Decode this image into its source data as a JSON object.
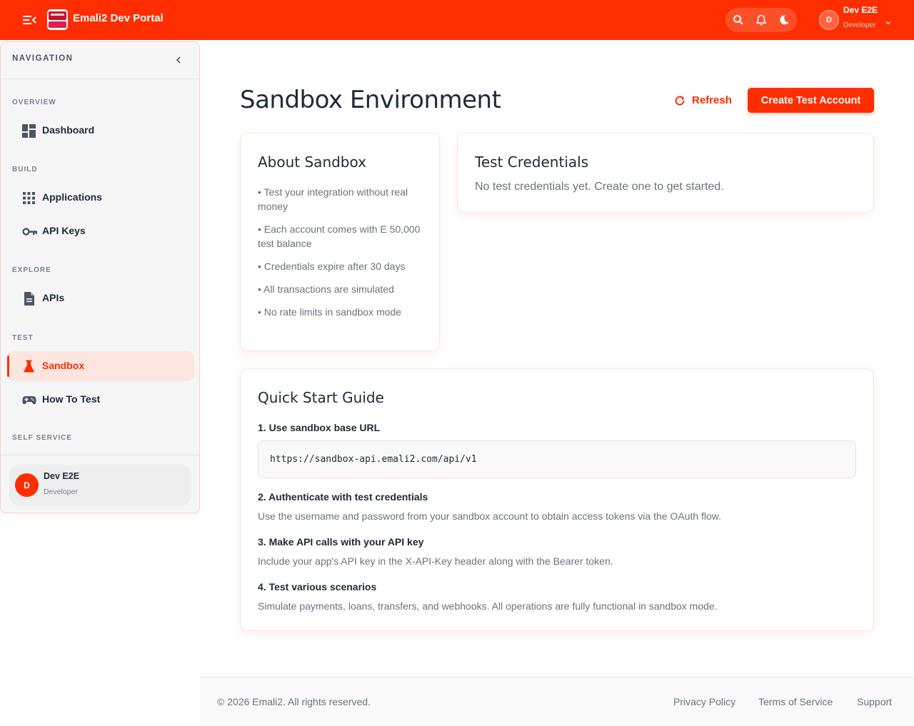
{
  "app": {
    "title": "Emali2 Dev Portal",
    "brand_color": "#ff2e00"
  },
  "header": {
    "icons": [
      "menu-icon",
      "search-icon",
      "bell-icon",
      "moon-icon",
      "chevron-down-icon"
    ],
    "user": {
      "initial": "D",
      "name": "Dev E2E",
      "role": "Developer"
    }
  },
  "sidebar": {
    "title": "NAVIGATION",
    "sections": {
      "overview": "OVERVIEW",
      "build": "BUILD",
      "explore": "EXPLORE",
      "test": "TEST",
      "self_service": "SELF SERVICE"
    },
    "items": {
      "dashboard": "Dashboard",
      "applications": "Applications",
      "api_keys": "API Keys",
      "apis": "APIs",
      "sandbox": "Sandbox",
      "how_to_test": "How To Test"
    },
    "active_item": "Sandbox",
    "user": {
      "initial": "D",
      "name": "Dev E2E",
      "role": "Developer"
    }
  },
  "main": {
    "title": "Sandbox Environment",
    "refresh_label": "Refresh",
    "create_label": "Create Test Account",
    "about": {
      "title": "About Sandbox",
      "bullets": [
        "• Test your integration without real money",
        "• Each account comes with E 50,000 test balance",
        "• Credentials expire after 30 days",
        "• All transactions are simulated",
        "• No rate limits in sandbox mode"
      ]
    },
    "credentials": {
      "title": "Test Credentials",
      "empty_text": "No test credentials yet. Create one to get started."
    },
    "guide": {
      "title": "Quick Start Guide",
      "steps": [
        {
          "title": "1. Use sandbox base URL",
          "code": "https://sandbox-api.emali2.com/api/v1"
        },
        {
          "title": "2. Authenticate with test credentials",
          "desc": "Use the username and password from your sandbox account to obtain access tokens via the OAuth flow."
        },
        {
          "title": "3. Make API calls with your API key",
          "desc": "Include your app's API key in the X-API-Key header along with the Bearer token."
        },
        {
          "title": "4. Test various scenarios",
          "desc": "Simulate payments, loans, transfers, and webhooks. All operations are fully functional in sandbox mode."
        }
      ]
    }
  },
  "footer": {
    "copyright": "© 2026 Emali2. All rights reserved.",
    "links": [
      "Privacy Policy",
      "Terms of Service",
      "Support"
    ]
  }
}
